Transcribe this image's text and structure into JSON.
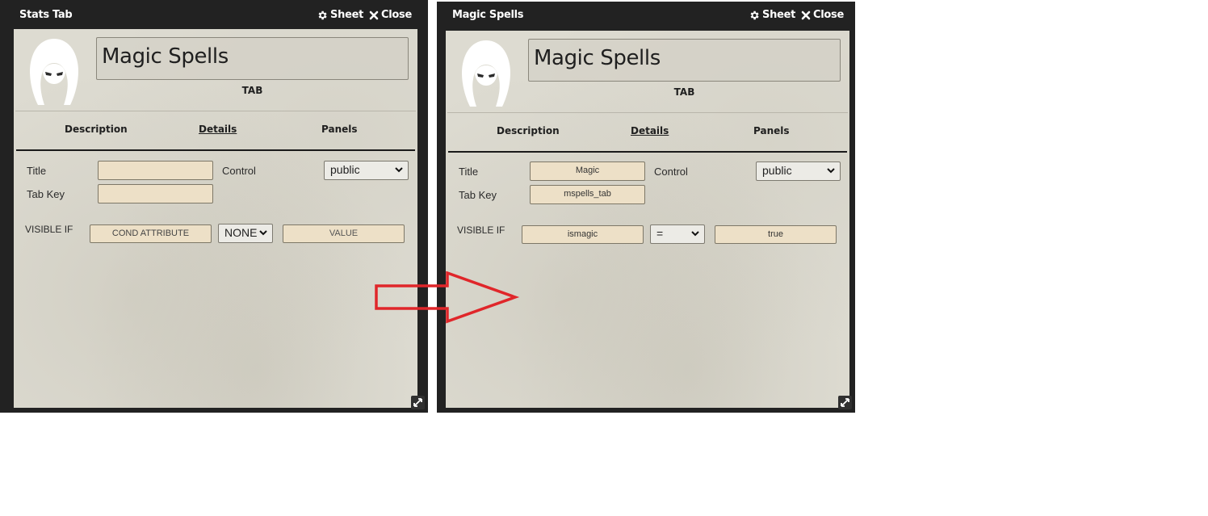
{
  "left": {
    "titlebar": {
      "title": "Stats Tab",
      "sheet_label": "Sheet",
      "close_label": "Close"
    },
    "name": "Magic Spells",
    "subtitle": "TAB",
    "nav": {
      "description": "Description",
      "details": "Details",
      "panels": "Panels"
    },
    "form": {
      "title_label": "Title",
      "title_value": "",
      "tabkey_label": "Tab Key",
      "tabkey_value": "",
      "control_label": "Control",
      "control_value": "public",
      "visible_if_label": "VISIBLE IF",
      "cond_attribute_placeholder": "COND ATTRIBUTE",
      "operator_value": "NONE",
      "value_placeholder": "VALUE"
    }
  },
  "right": {
    "titlebar": {
      "title": "Magic Spells",
      "sheet_label": "Sheet",
      "close_label": "Close"
    },
    "name": "Magic Spells",
    "subtitle": "TAB",
    "nav": {
      "description": "Description",
      "details": "Details",
      "panels": "Panels"
    },
    "form": {
      "title_label": "Title",
      "title_value": "Magic",
      "tabkey_label": "Tab Key",
      "tabkey_value": "mspells_tab",
      "control_label": "Control",
      "control_value": "public",
      "visible_if_label": "VISIBLE IF",
      "cond_attribute_value": "ismagic",
      "operator_value": "=",
      "value_value": "true"
    }
  },
  "colors": {
    "arrow": "#e0262a",
    "field_bg": "#ede0c7",
    "frame": "#222222",
    "paper": "#dddbd1"
  },
  "icons": [
    "gear-icon",
    "close-icon",
    "hooded-figure-icon",
    "chevron-down-icon",
    "resize-icon",
    "arrow-right-icon"
  ]
}
